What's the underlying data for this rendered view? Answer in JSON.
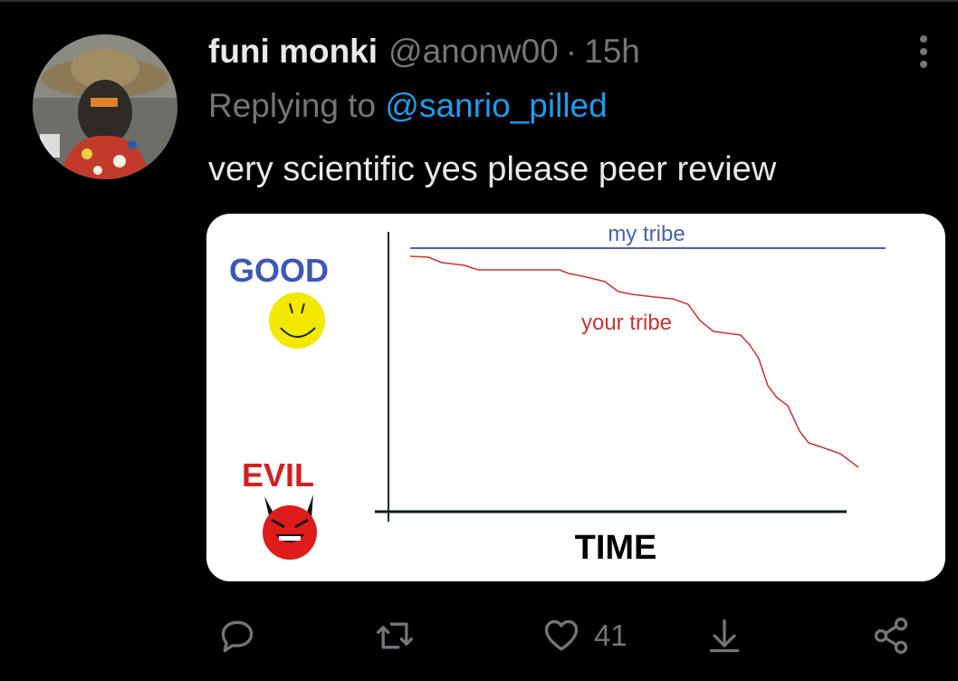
{
  "tweet": {
    "author_name": "funi monki",
    "handle": "@anonw00",
    "separator": "·",
    "time": "15h",
    "replying_prefix": "Replying to",
    "replying_to": "@sanrio_pilled",
    "text": "very scientific yes please peer review"
  },
  "media": {
    "label_good": "GOOD",
    "label_evil": "EVIL",
    "label_my_tribe": "my tribe",
    "label_your_tribe": "your tribe",
    "label_time": "TIME",
    "colors": {
      "good": "#3b57b7",
      "evil": "#d42020",
      "my_tribe_line": "#4a5fb8",
      "your_tribe_line": "#d03030",
      "smiley": "#f2e800",
      "devil": "#e01b1b"
    }
  },
  "actions": {
    "reply_icon": "reply-icon",
    "retweet_icon": "retweet-icon",
    "like_icon": "heart-icon",
    "like_count": "41",
    "download_icon": "download-icon",
    "share_icon": "share-icon"
  },
  "colors": {
    "background": "#000000",
    "primary_text": "#e7e9ea",
    "secondary_text": "#71767b",
    "link": "#1d9bf0"
  }
}
